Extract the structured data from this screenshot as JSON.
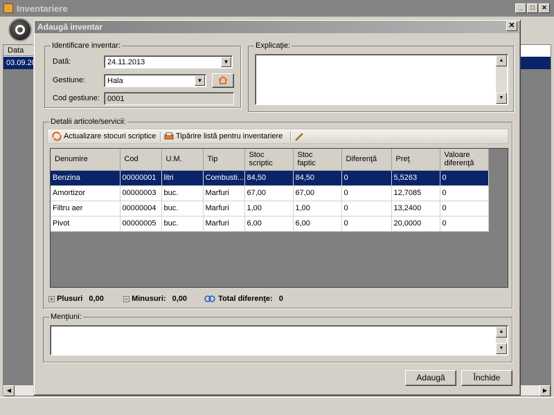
{
  "main_window": {
    "title": "Inventariere",
    "grid_header_date": "Data",
    "selected_row_value": "03.09.20"
  },
  "dialog": {
    "title": "Adaugă inventar",
    "ident_group": {
      "legend": "Identificare inventar:",
      "date_label": "Dată:",
      "date_value": "24.11.2013",
      "gestiune_label": "Gestiune:",
      "gestiune_value": "Hala",
      "cod_label": "Cod gestiune:",
      "cod_value": "0001"
    },
    "explicatie_legend": "Explicaţie:",
    "details_legend": "Detalii articole/servicii:",
    "toolbar": {
      "update_label": "Actualizare stocuri scriptice",
      "print_label": "Tipărire listă pentru inventariere"
    },
    "table": {
      "columns": [
        "Denumire",
        "Cod",
        "U.M.",
        "Tip",
        "Stoc\nscriptic",
        "Stoc\nfaptic",
        "Diferenţă",
        "Preţ",
        "Valoare\ndiferenţă"
      ],
      "rows": [
        [
          "Benzina",
          "00000001",
          "litri",
          "Combusti...",
          "84,50",
          "84,50",
          "0",
          "5,5263",
          "0"
        ],
        [
          "Amortizor",
          "00000003",
          "buc.",
          "Marfuri",
          "67,00",
          "67,00",
          "0",
          "12,7085",
          "0"
        ],
        [
          "Filtru aer",
          "00000004",
          "buc.",
          "Marfuri",
          "1,00",
          "1,00",
          "0",
          "13,2400",
          "0"
        ],
        [
          "Pivot",
          "00000005",
          "buc.",
          "Marfuri",
          "6,00",
          "6,00",
          "0",
          "20,0000",
          "0"
        ]
      ],
      "selected_row": 0
    },
    "summary": {
      "plus_label": "Plusuri",
      "plus_value": "0,00",
      "minus_label": "Minusuri:",
      "minus_value": "0,00",
      "total_label": "Total diferenţe:",
      "total_value": "0"
    },
    "mentiuni_legend": "Menţiuni:",
    "buttons": {
      "add": "Adaugă",
      "close": "Închide"
    }
  },
  "colors": {
    "selection": "#0a246a",
    "face": "#d4d0c8",
    "inactive_title": "#808080"
  }
}
